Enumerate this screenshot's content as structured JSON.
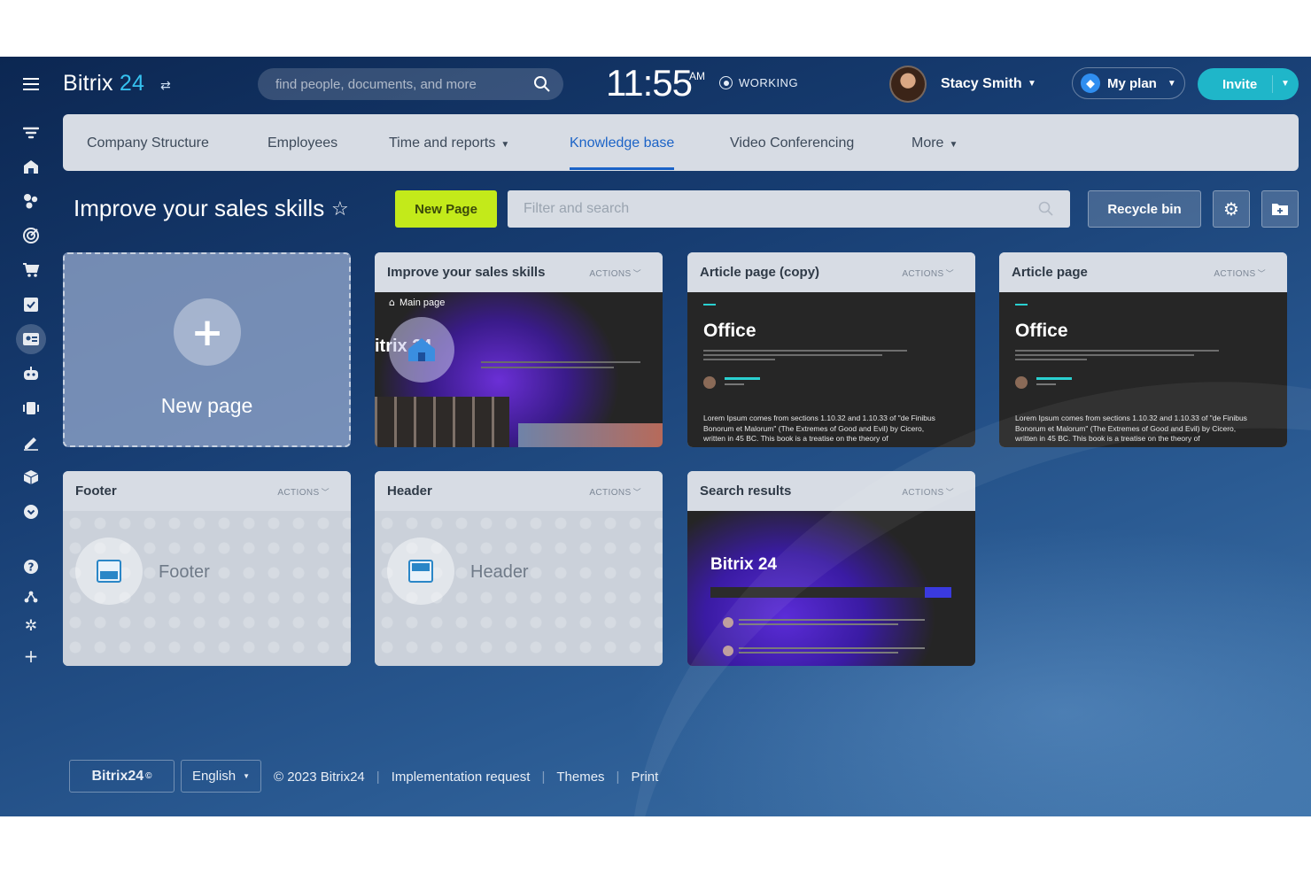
{
  "header": {
    "logo_text": "Bitrix",
    "logo_number": "24",
    "search_placeholder": "find people, documents, and more",
    "time": "11:55",
    "ampm": "AM",
    "status": "WORKING",
    "user_name": "Stacy Smith",
    "plan_label": "My plan",
    "invite_label": "Invite"
  },
  "sidebar": {
    "icons": [
      "filter-icon",
      "home-icon",
      "feed-icon",
      "target-icon",
      "cart-icon",
      "tasks-icon",
      "contacts-icon",
      "robot-icon",
      "video-icon",
      "sign-icon",
      "box-icon",
      "chevron-down-icon",
      "help-icon",
      "sitemap-icon",
      "gear-icon",
      "plus-icon"
    ]
  },
  "nav": {
    "items": [
      {
        "label": "Company Structure"
      },
      {
        "label": "Employees"
      },
      {
        "label": "Time and reports"
      },
      {
        "label": "Knowledge base"
      },
      {
        "label": "Video Conferencing"
      },
      {
        "label": "More"
      }
    ],
    "active": "Knowledge base"
  },
  "toolbar": {
    "title": "Improve your sales skills",
    "new_page_label": "New Page",
    "filter_placeholder": "Filter and search",
    "recycle_label": "Recycle bin"
  },
  "new_card": {
    "label": "New page"
  },
  "cards": [
    {
      "title": "Improve your sales skills",
      "actions": "ACTIONS",
      "breadcrumb": "Main page",
      "logo_text": "itrix 24"
    },
    {
      "title": "Article page (copy)",
      "actions": "ACTIONS",
      "heading": "Office",
      "paragraph": "Lorem Ipsum comes from sections 1.10.32 and 1.10.33 of \"de Finibus Bonorum et Malorum\" (The Extremes of Good and Evil) by Cicero, written in 45 BC. This book is a treatise on the theory of"
    },
    {
      "title": "Article page",
      "actions": "ACTIONS",
      "heading": "Office",
      "paragraph": "Lorem Ipsum comes from sections 1.10.32 and 1.10.33 of \"de Finibus Bonorum et Malorum\" (The Extremes of Good and Evil) by Cicero, written in 45 BC. This book is a treatise on the theory of"
    },
    {
      "title": "Footer",
      "actions": "ACTIONS",
      "label": "Footer"
    },
    {
      "title": "Header",
      "actions": "ACTIONS",
      "label": "Header"
    },
    {
      "title": "Search results",
      "actions": "ACTIONS",
      "heading": "Bitrix 24"
    }
  ],
  "footer": {
    "brand": "Bitrix24",
    "language": "English",
    "copyright": "© 2023 Bitrix24",
    "links": [
      "Implementation request",
      "Themes",
      "Print"
    ]
  },
  "colors": {
    "accent_blue": "#1b63c7",
    "new_page_green": "#c3ea1a",
    "invite_teal": "#1fb6c9",
    "logo_number": "#36c2f0"
  }
}
